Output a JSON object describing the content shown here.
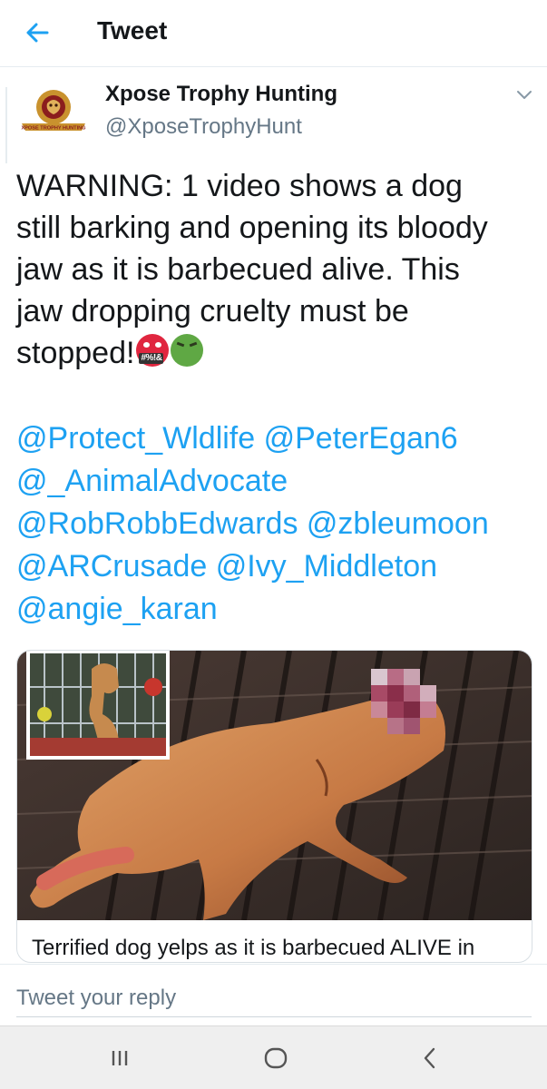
{
  "header": {
    "title": "Tweet",
    "back_icon": "arrow-left-icon"
  },
  "colors": {
    "accent": "#1da1f2",
    "text": "#14171a",
    "secondary": "#657786",
    "avatar_gold": "#c9922e",
    "avatar_maroon": "#8b1d1d"
  },
  "tweet": {
    "author_name": "Xpose Trophy Hunting",
    "author_handle": "@XposeTrophyHunt",
    "avatar_text": "XPOSE TROPHY HUNTING",
    "text_lines": [
      "WARNING: 1 video shows a dog",
      "still barking and opening its bloody",
      "jaw as it is barbecued alive. This",
      "jaw dropping cruelty must be",
      "stopped!"
    ],
    "emoji": [
      {
        "name": "face-with-symbols-on-mouth",
        "text": "#%!&"
      },
      {
        "name": "nauseated-face"
      }
    ],
    "mentions": [
      "@Protect_Wldlife",
      "@PeterEgan6",
      "@_AnimalAdvocate",
      "@RobRobbEdwards",
      "@zbleumoon",
      "@ARCrusade",
      "@Ivy_Middleton",
      "@angie_karan"
    ]
  },
  "card": {
    "title": "Terrified dog yelps as it is barbecued ALIVE in"
  },
  "reply": {
    "placeholder": "Tweet your reply"
  },
  "system_nav": {
    "recents_icon": "recent-apps-icon",
    "home_icon": "home-icon",
    "back_icon": "back-chevron-icon"
  }
}
